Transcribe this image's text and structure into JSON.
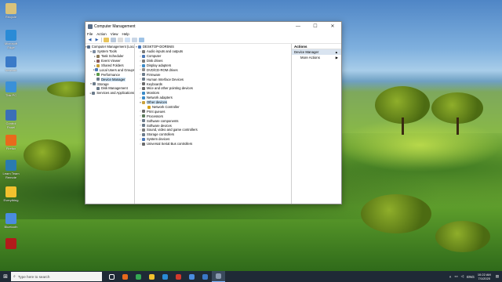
{
  "desktop": {
    "icons": [
      {
        "label": "Recycle",
        "color": "#d9c27a"
      },
      {
        "label": "Microsoft Edge",
        "color": "#2a8bd6"
      },
      {
        "label": "Network",
        "color": "#3a7ac8"
      },
      {
        "label": "This PC",
        "color": "#3a90d8"
      },
      {
        "label": "Control Panel",
        "color": "#3b6fb7"
      },
      {
        "label": "Firefox",
        "color": "#e96a1c"
      },
      {
        "label": "Learn Team Remote",
        "color": "#2a7bb0"
      },
      {
        "label": "Everything",
        "color": "#f2c12e"
      },
      {
        "label": "Bluetooth",
        "color": "#4a8cdf"
      },
      {
        "label": "",
        "color": "#b21b1b"
      }
    ]
  },
  "window": {
    "title": "Computer Management",
    "controls": {
      "minimize": "—",
      "maximize": "☐",
      "close": "✕"
    },
    "menu": [
      "File",
      "Action",
      "View",
      "Help"
    ],
    "toolbar_icons": [
      "back-icon",
      "forward-icon",
      "up-icon",
      "show-hide-tree-icon",
      "properties-icon",
      "help-icon",
      "view-icon",
      "refresh-icon"
    ]
  },
  "left_tree": [
    {
      "label": "Computer Management (Local",
      "level": 0,
      "expanded": true,
      "icon_color": "#5a6f8a"
    },
    {
      "label": "System Tools",
      "level": 1,
      "expanded": true,
      "icon_color": "#7a8aa0"
    },
    {
      "label": "Task Scheduler",
      "level": 2,
      "expanded": false,
      "icon_color": "#8a7a5a"
    },
    {
      "label": "Event Viewer",
      "level": 2,
      "expanded": false,
      "icon_color": "#8a5a5a"
    },
    {
      "label": "Shared Folders",
      "level": 2,
      "expanded": false,
      "icon_color": "#c9a13a"
    },
    {
      "label": "Local Users and Groups",
      "level": 2,
      "expanded": false,
      "icon_color": "#4a78b8"
    },
    {
      "label": "Performance",
      "level": 2,
      "expanded": false,
      "icon_color": "#5a9a4a"
    },
    {
      "label": "Device Manager",
      "level": 2,
      "expanded": null,
      "icon_color": "#6a7a8a",
      "selected": true
    },
    {
      "label": "Storage",
      "level": 1,
      "expanded": true,
      "icon_color": "#6a7a8a"
    },
    {
      "label": "Disk Management",
      "level": 2,
      "expanded": null,
      "icon_color": "#6a7a8a"
    },
    {
      "label": "Services and Applications",
      "level": 1,
      "expanded": false,
      "icon_color": "#6a7a8a"
    }
  ],
  "device_tree": {
    "root": "DESKTOP-DOR5NIS",
    "items": [
      {
        "label": "Audio inputs and outputs",
        "icon_color": "#7a7a7a"
      },
      {
        "label": "Computer",
        "icon_color": "#4a78b8"
      },
      {
        "label": "Disk drives",
        "icon_color": "#7a7a7a"
      },
      {
        "label": "Display adapters",
        "icon_color": "#3a8ac8"
      },
      {
        "label": "DVD/CD-ROM drives",
        "icon_color": "#8a8a8a"
      },
      {
        "label": "Firmware",
        "icon_color": "#6a7a8a"
      },
      {
        "label": "Human Interface Devices",
        "icon_color": "#6a7a8a"
      },
      {
        "label": "Keyboards",
        "icon_color": "#6a6a6a"
      },
      {
        "label": "Mice and other pointing devices",
        "icon_color": "#6a6a6a"
      },
      {
        "label": "Monitors",
        "icon_color": "#3a8ac8"
      },
      {
        "label": "Network adapters",
        "icon_color": "#3a8ac8"
      },
      {
        "label": "Other devices",
        "icon_color": "#c9a13a",
        "expanded": true,
        "highlight": true
      },
      {
        "label": "Network Controller",
        "icon_color": "#d4a017",
        "child": true
      },
      {
        "label": "Print queues",
        "icon_color": "#6a6a6a"
      },
      {
        "label": "Processors",
        "icon_color": "#5a7a5a"
      },
      {
        "label": "Software components",
        "icon_color": "#6a7a8a"
      },
      {
        "label": "Software devices",
        "icon_color": "#6a7a8a"
      },
      {
        "label": "Sound, video and game controllers",
        "icon_color": "#7a7a7a"
      },
      {
        "label": "Storage controllers",
        "icon_color": "#6a7a8a"
      },
      {
        "label": "System devices",
        "icon_color": "#4a78b8"
      },
      {
        "label": "Universal Serial Bus controllers",
        "icon_color": "#6a6a6a"
      }
    ]
  },
  "actions": {
    "header": "Actions",
    "section": "Device Manager",
    "section_arrow": "▲",
    "more": "More Actions",
    "more_arrow": "▶"
  },
  "taskbar": {
    "start_icon": "windows-logo-icon",
    "search_placeholder": "Type here to search",
    "apps": [
      {
        "name": "task-view-icon",
        "color": "#ffffff"
      },
      {
        "name": "firefox-icon",
        "color": "#e96a1c"
      },
      {
        "name": "chrome-icon",
        "color": "#34a853"
      },
      {
        "name": "file-explorer-icon",
        "color": "#f2c12e"
      },
      {
        "name": "edge-icon",
        "color": "#2a8bd6"
      },
      {
        "name": "app-red-icon",
        "color": "#d33a2c"
      },
      {
        "name": "store-icon",
        "color": "#4a8cdf"
      },
      {
        "name": "app-blue-icon",
        "color": "#3a78c8"
      },
      {
        "name": "computer-management-icon",
        "color": "#8a9ab0",
        "active": true
      }
    ],
    "tray": {
      "lang": "ENG",
      "time": "10:22 AM",
      "date": "7/1/2020"
    }
  }
}
